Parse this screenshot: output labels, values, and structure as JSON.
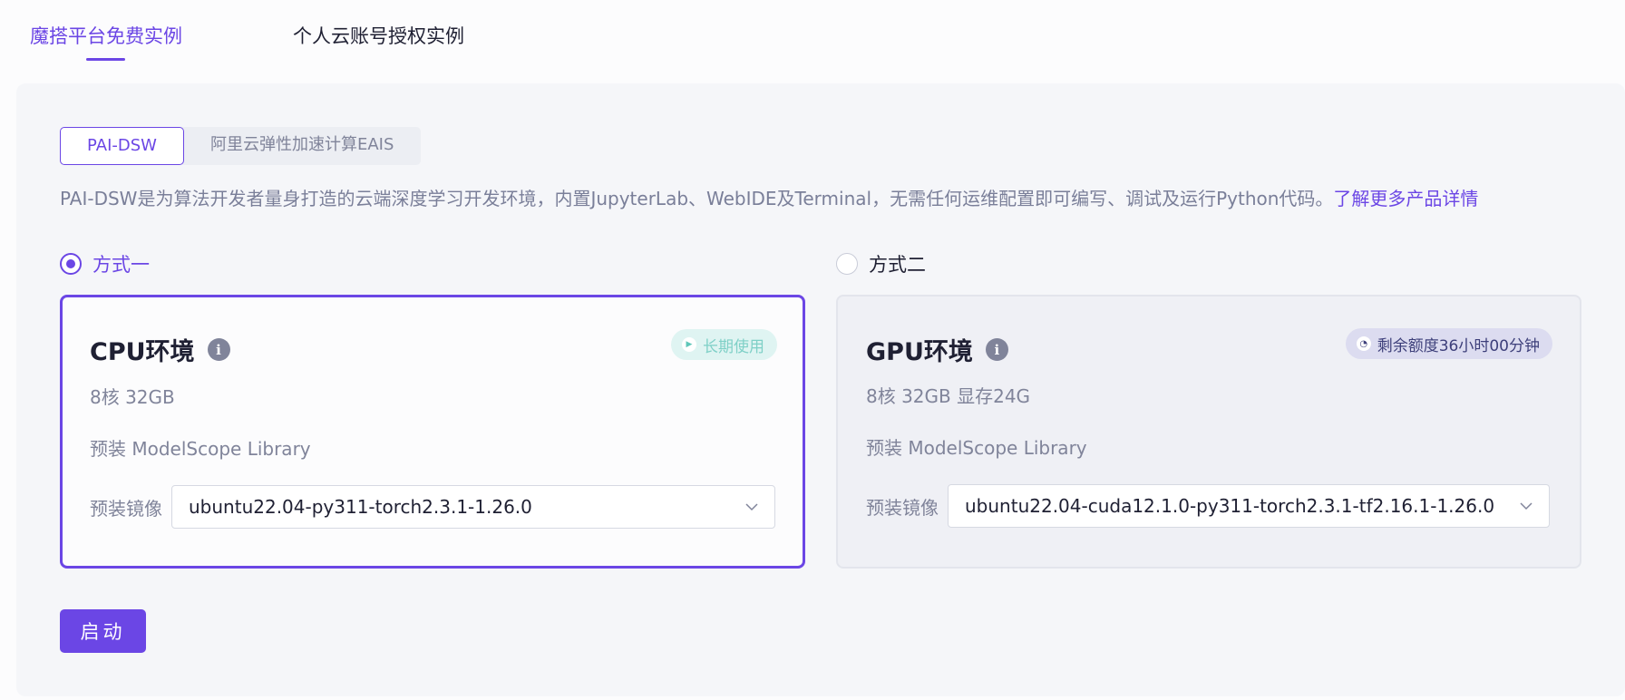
{
  "top_tabs": [
    {
      "label": "魔搭平台免费实例",
      "active": true
    },
    {
      "label": "个人云账号授权实例",
      "active": false
    }
  ],
  "sub_tabs": [
    {
      "label": "PAI-DSW",
      "active": true
    },
    {
      "label": "阿里云弹性加速计算EAIS",
      "active": false
    }
  ],
  "description": {
    "text": "PAI-DSW是为算法开发者量身打造的云端深度学习开发环境，内置JupyterLab、WebIDE及Terminal，无需任何运维配置即可编写、调试及运行Python代码。",
    "link": "了解更多产品详情"
  },
  "options": [
    {
      "radio_label": "方式一",
      "selected": true,
      "title": "CPU环境",
      "badge": "长期使用",
      "badge_icon": "play-icon",
      "spec": "8核 32GB",
      "preinstall": "预装 ModelScope Library",
      "image_label": "预装镜像",
      "image_value": "ubuntu22.04-py311-torch2.3.1-1.26.0"
    },
    {
      "radio_label": "方式二",
      "selected": false,
      "title": "GPU环境",
      "badge": "剩余额度36小时00分钟",
      "badge_icon": "clock-icon",
      "spec": "8核 32GB 显存24G",
      "preinstall": "预装 ModelScope Library",
      "image_label": "预装镜像",
      "image_value": "ubuntu22.04-cuda12.1.0-py311-torch2.3.1-tf2.16.1-1.26.0"
    }
  ],
  "start_button": "启动",
  "colors": {
    "accent": "#6b46e5",
    "muted_text": "#80849a",
    "panel_bg": "#f5f6f9",
    "cpu_badge_bg": "#dff4f2",
    "gpu_badge_bg": "#dcdcf0"
  }
}
